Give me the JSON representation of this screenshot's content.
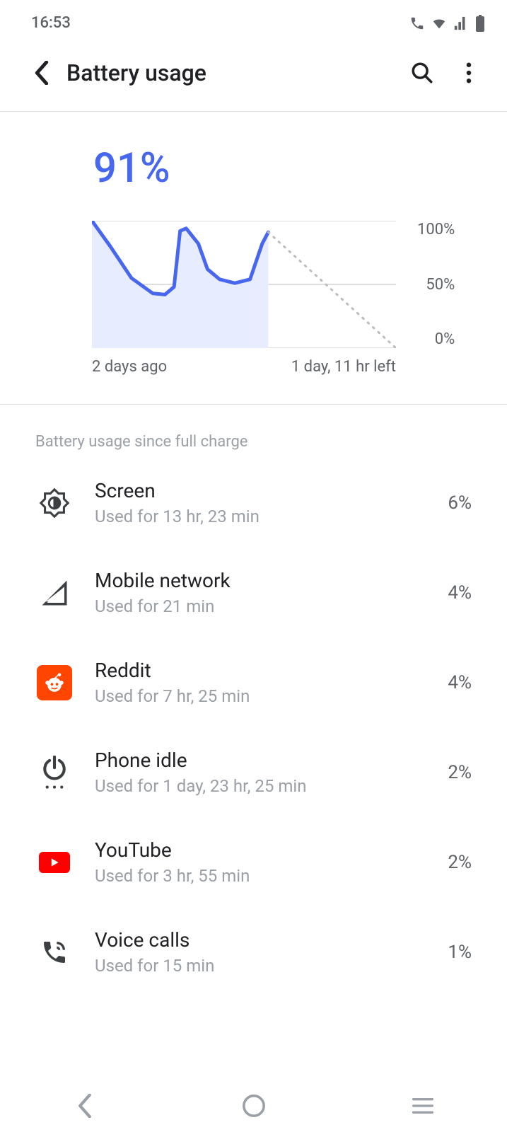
{
  "status": {
    "time": "16:53"
  },
  "header": {
    "title": "Battery usage"
  },
  "chart_data": {
    "type": "line",
    "title": "",
    "xlabel": "",
    "ylabel": "",
    "ylim": [
      0,
      100
    ],
    "yticks": [
      "100%",
      "50%",
      "0%"
    ],
    "x_labels": {
      "start": "2 days ago",
      "end": "1 day, 11 hr left"
    },
    "current_level": "91%",
    "x": [
      0,
      0.06,
      0.13,
      0.2,
      0.24,
      0.27,
      0.29,
      0.31,
      0.35,
      0.38,
      0.42,
      0.47,
      0.52,
      0.56,
      0.58
    ],
    "values": [
      100,
      80,
      55,
      43,
      42,
      48,
      92,
      94,
      82,
      62,
      54,
      51,
      54,
      82,
      91
    ],
    "projection": {
      "start_x": 0.58,
      "start_y": 91,
      "end_x": 1.0,
      "end_y": 0
    }
  },
  "section_label": "Battery usage since full charge",
  "items": [
    {
      "name": "Screen",
      "sub": "Used for 13 hr, 23 min",
      "pct": "6%",
      "icon": "brightness"
    },
    {
      "name": "Mobile network",
      "sub": "Used for 21 min",
      "pct": "4%",
      "icon": "cell"
    },
    {
      "name": "Reddit",
      "sub": "Used for 7 hr, 25 min",
      "pct": "4%",
      "icon": "reddit"
    },
    {
      "name": "Phone idle",
      "sub": "Used for 1 day, 23 hr, 25 min",
      "pct": "2%",
      "icon": "power"
    },
    {
      "name": "YouTube",
      "sub": "Used for 3 hr, 55 min",
      "pct": "2%",
      "icon": "youtube"
    },
    {
      "name": "Voice calls",
      "sub": "Used for 15 min",
      "pct": "1%",
      "icon": "phone"
    }
  ]
}
